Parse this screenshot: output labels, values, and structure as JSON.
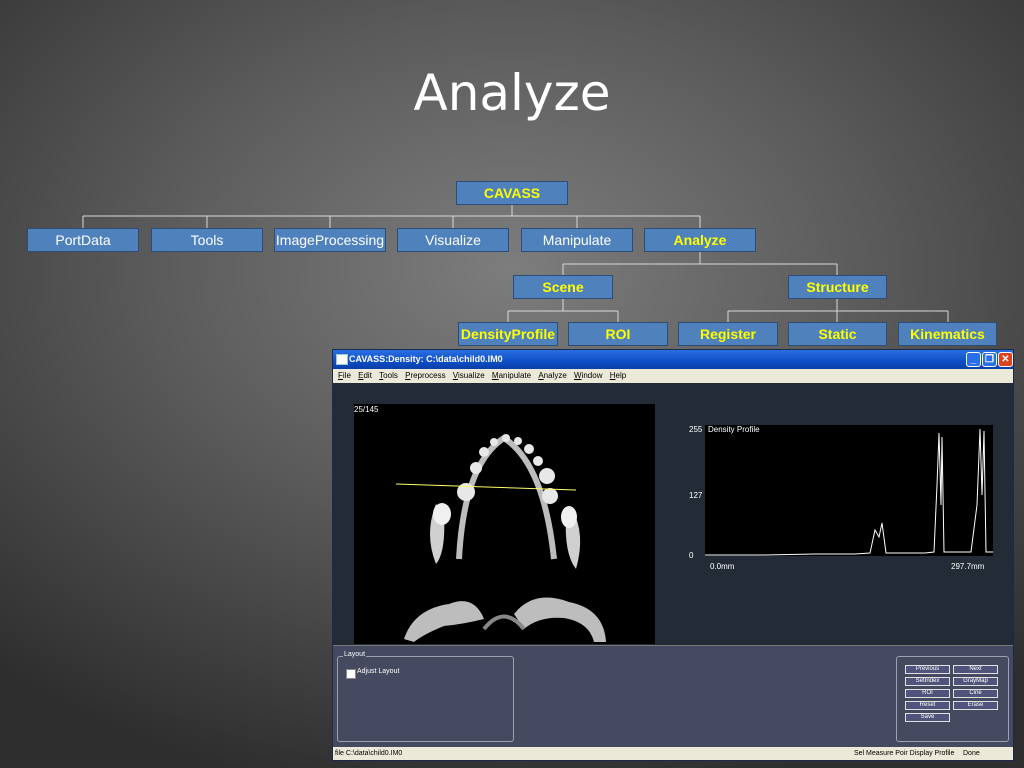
{
  "slide": {
    "title": "Analyze"
  },
  "tree": {
    "root": "CAVASS",
    "level1": [
      "PortData",
      "Tools",
      "ImageProcessing",
      "Visualize",
      "Manipulate",
      "Analyze"
    ],
    "level2": [
      "Scene",
      "Structure"
    ],
    "level3": [
      "DensityProfile",
      "ROI",
      "Register",
      "Static",
      "Kinematics"
    ],
    "highlight_color": "#ffff00",
    "node_color": "#4f81bd"
  },
  "window": {
    "title": "CAVASS:Density: C:\\data\\child0.IM0",
    "buttons": {
      "minimize": "_",
      "maximize": "❐",
      "close": "✕"
    },
    "menu": [
      "File",
      "Edit",
      "Tools",
      "Preprocess",
      "Visualize",
      "Manipulate",
      "Analyze",
      "Window",
      "Help"
    ],
    "slice_indicator": "25/145",
    "profile": {
      "title": "Density Profile",
      "y_ticks": [
        "255",
        "127",
        "0"
      ],
      "x_start": "0.0mm",
      "x_end": "297.7mm"
    },
    "layout_group": {
      "label": "Layout",
      "checkbox_label": "Adjust Layout",
      "checked": false
    },
    "control_buttons": [
      "Previous",
      "Next",
      "SetIndex",
      "GrayMap",
      "ROI",
      "Cine",
      "Reset",
      "Erase",
      "Save"
    ],
    "status": {
      "file": "file C:\\data\\child0.IM0",
      "mode": "Sel Measure Poir Display Profile",
      "state": "Done"
    }
  }
}
